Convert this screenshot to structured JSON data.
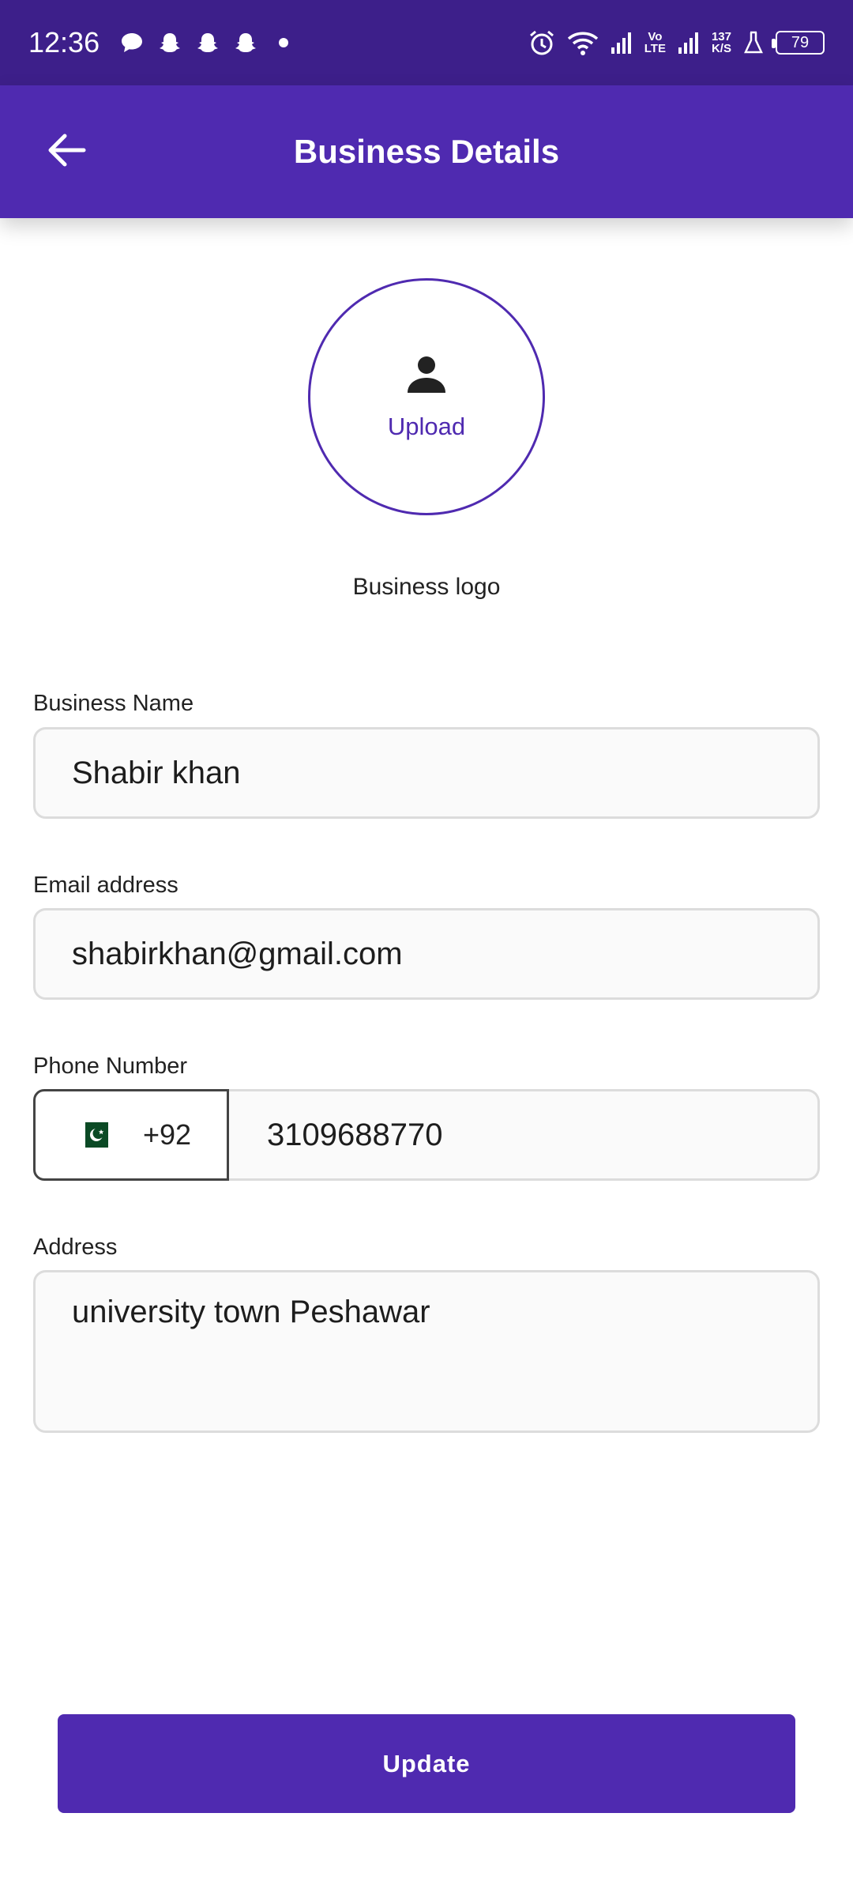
{
  "status_bar": {
    "time": "12:36",
    "signal_label_top": "Vo",
    "signal_label_bottom": "LTE",
    "speed_top": "137",
    "speed_bottom": "K/S",
    "battery": "79"
  },
  "app_bar": {
    "title": "Business Details",
    "back_icon": "arrow-back-icon"
  },
  "logo": {
    "upload_label": "Upload",
    "caption": "Business logo",
    "icon": "person-icon"
  },
  "form": {
    "business_name_label": "Business Name",
    "business_name_value": "Shabir khan",
    "email_label": "Email address",
    "email_value": "shabirkhan@gmail.com",
    "phone_label": "Phone Number",
    "country_code": "+92",
    "phone_value": "3109688770",
    "address_label": "Address",
    "address_value": "university town Peshawar"
  },
  "actions": {
    "update_label": "Update"
  },
  "colors": {
    "status_bar": "#3d1f8a",
    "primary": "#4f2ab0"
  }
}
